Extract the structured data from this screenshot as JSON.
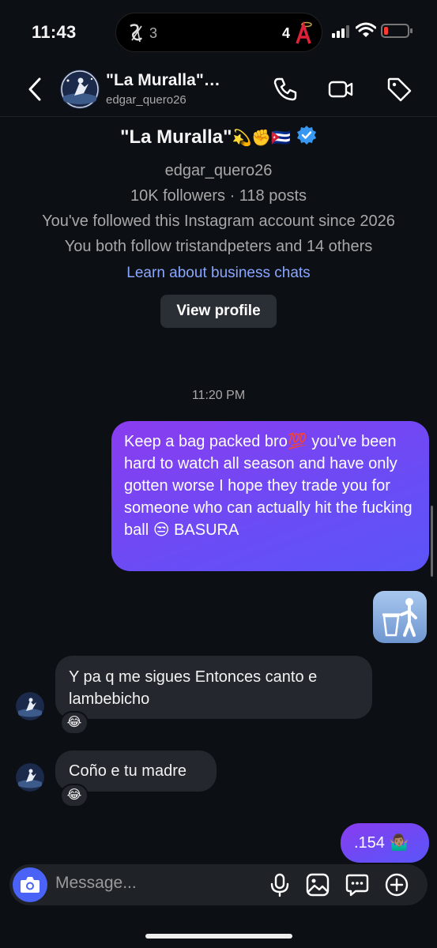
{
  "status_bar": {
    "time": "11:43",
    "score_left": "3",
    "score_right": "4"
  },
  "header": {
    "name": "\"La Muralla\"…",
    "username": "edgar_quero26"
  },
  "profile": {
    "name": "\"La Muralla\"",
    "name_emojis": "💫✊🇨🇺",
    "username": "edgar_quero26",
    "stats": "10K followers · 118 posts",
    "followed_since": "You've followed this Instagram account since 2026",
    "mutuals": "You both follow tristandpeters and 14 others",
    "learn_link": "Learn about business chats",
    "view_profile_label": "View profile"
  },
  "timestamp": "11:20 PM",
  "messages": [
    {
      "from": "me",
      "text": "Keep a bag packed bro💯 you've been hard to watch all season and have only gotten worse I hope they trade you for someone who can actually hit the fucking ball 😒 BASURA"
    },
    {
      "from": "me",
      "emoji": "🚮"
    },
    {
      "from": "them",
      "text": "Y pa q me sigues Entonces canto e lambebicho",
      "reaction": "😂"
    },
    {
      "from": "them",
      "text": "Coño e tu madre",
      "reaction": "😂"
    },
    {
      "from": "me",
      "text": ".154 🤷🏽‍♂️"
    }
  ],
  "composer": {
    "placeholder": "Message..."
  },
  "colors": {
    "background": "#0c0f14",
    "outgoing_bubble": "#7a45f2",
    "incoming_bubble": "#24272d",
    "link": "#8aa7ff",
    "camera_button": "#4a62f6"
  },
  "icons": [
    "back-chevron-icon",
    "phone-icon",
    "video-call-icon",
    "tag-icon",
    "verified-badge-icon",
    "camera-icon",
    "microphone-icon",
    "gallery-icon",
    "sticker-icon",
    "plus-icon"
  ]
}
